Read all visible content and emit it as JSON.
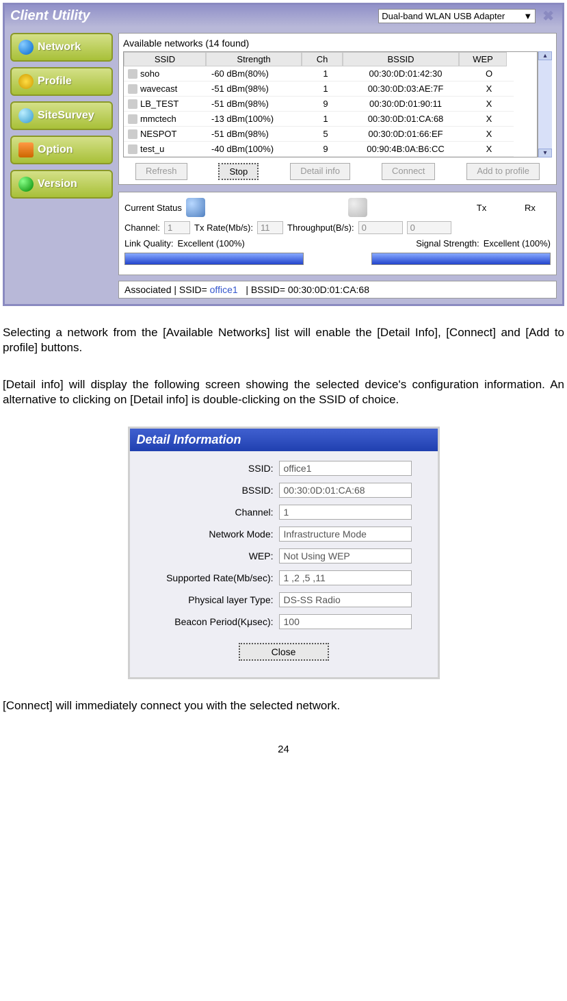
{
  "window": {
    "title": "Client Utility",
    "adapter": "Dual-band WLAN USB Adapter"
  },
  "sidebar": {
    "items": [
      {
        "label": "Network"
      },
      {
        "label": "Profile"
      },
      {
        "label": "SiteSurvey"
      },
      {
        "label": "Option"
      },
      {
        "label": "Version"
      }
    ]
  },
  "networks": {
    "title": "Available networks  (14 found)",
    "headers": {
      "ssid": "SSID",
      "strength": "Strength",
      "ch": "Ch",
      "bssid": "BSSID",
      "wep": "WEP"
    },
    "rows": [
      {
        "ssid": "soho",
        "strength": "-60 dBm(80%)",
        "ch": "1",
        "bssid": "00:30:0D:01:42:30",
        "wep": "O"
      },
      {
        "ssid": "wavecast",
        "strength": "-51 dBm(98%)",
        "ch": "1",
        "bssid": "00:30:0D:03:AE:7F",
        "wep": "X"
      },
      {
        "ssid": "LB_TEST",
        "strength": "-51 dBm(98%)",
        "ch": "9",
        "bssid": "00:30:0D:01:90:11",
        "wep": "X"
      },
      {
        "ssid": "mmctech",
        "strength": "-13 dBm(100%)",
        "ch": "1",
        "bssid": "00:30:0D:01:CA:68",
        "wep": "X"
      },
      {
        "ssid": "NESPOT",
        "strength": "-51 dBm(98%)",
        "ch": "5",
        "bssid": "00:30:0D:01:66:EF",
        "wep": "X"
      },
      {
        "ssid": "test_u",
        "strength": "-40 dBm(100%)",
        "ch": "9",
        "bssid": "00:90:4B:0A:B6:CC",
        "wep": "X"
      }
    ],
    "buttons": {
      "refresh": "Refresh",
      "stop": "Stop",
      "detail": "Detail info",
      "connect": "Connect",
      "add": "Add to profile"
    }
  },
  "status": {
    "legend": "Current Status",
    "channel_label": "Channel:",
    "channel": "1",
    "txrate_label": "Tx Rate(Mb/s):",
    "txrate": "11",
    "throughput_label": "Throughput(B/s):",
    "tx_label": "Tx",
    "rx_label": "Rx",
    "tx": "0",
    "rx": "0",
    "link_label": "Link Quality:",
    "link": "Excellent (100%)",
    "signal_label": "Signal Strength:",
    "signal": "Excellent (100%)",
    "bar_prefix": "Associated | SSID=",
    "bar_ssid": "office1",
    "bar_suffix": "| BSSID= 00:30:0D:01:CA:68"
  },
  "doc": {
    "p1": "Selecting a network from the [Available Networks] list will enable the [Detail Info], [Connect] and [Add to profile] buttons.",
    "p2": "[Detail info] will display the following screen showing the selected device's configuration information. An alternative to clicking on [Detail info] is double-clicking on the SSID of choice.",
    "p3": "[Connect] will immediately connect you with the selected network.",
    "page": "24"
  },
  "detail": {
    "title": "Detail Information",
    "fields": [
      {
        "label": "SSID:",
        "value": "office1"
      },
      {
        "label": "BSSID:",
        "value": "00:30:0D:01:CA:68"
      },
      {
        "label": "Channel:",
        "value": "1"
      },
      {
        "label": "Network Mode:",
        "value": "Infrastructure Mode"
      },
      {
        "label": "WEP:",
        "value": "Not Using WEP"
      },
      {
        "label": "Supported Rate(Mb/sec):",
        "value": "1 ,2 ,5 ,11"
      },
      {
        "label": "Physical layer Type:",
        "value": "DS-SS Radio"
      },
      {
        "label": "Beacon Period(Kμsec):",
        "value": "100"
      }
    ],
    "close": "Close"
  }
}
